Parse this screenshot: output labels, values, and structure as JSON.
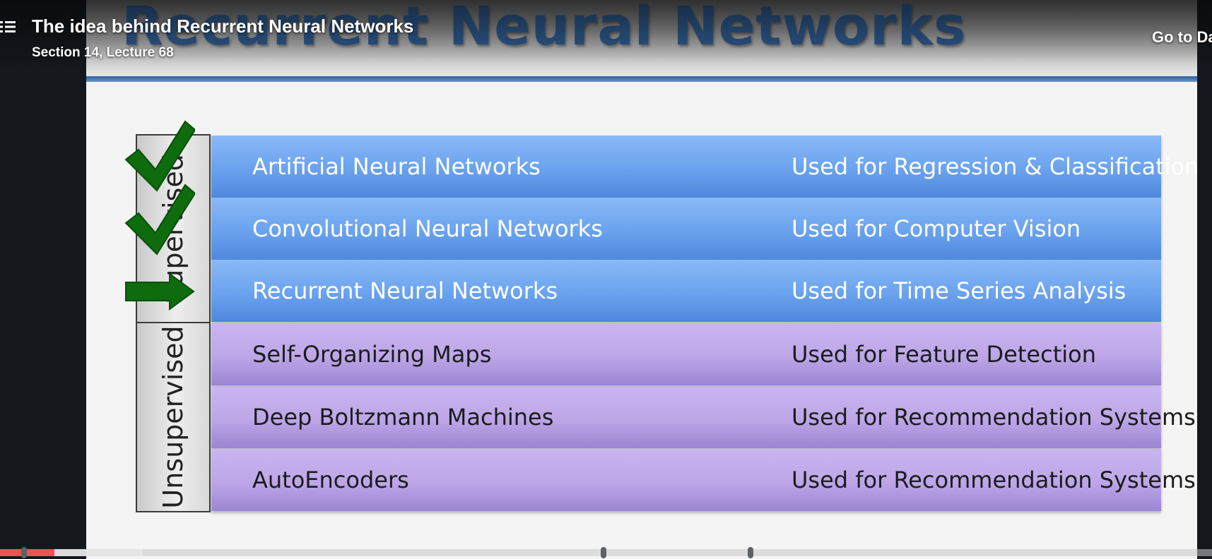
{
  "player": {
    "lecture_title": "The idea behind Recurrent Neural Networks",
    "lecture_subtitle": "Section 14, Lecture 68",
    "goto_link": "Go to Da",
    "progress": {
      "played_fraction": 0.045,
      "buffered_fraction": 0.118
    },
    "chapter_markers": [
      0.02,
      0.498,
      0.619
    ],
    "colors": {
      "progress_played": "#ec5252",
      "sidebar_bg": "#14181d"
    }
  },
  "slide": {
    "title": "Recurrent Neural Networks",
    "categories": {
      "supervised": "Supervised",
      "unsupervised": "Unsupervised"
    },
    "rows": [
      {
        "name": "Artificial Neural Networks",
        "use": "Used for Regression & Classification",
        "group": "supervised",
        "marker": "check"
      },
      {
        "name": "Convolutional Neural Networks",
        "use": "Used for Computer Vision",
        "group": "supervised",
        "marker": "check"
      },
      {
        "name": "Recurrent Neural Networks",
        "use": "Used for Time Series Analysis",
        "group": "supervised",
        "marker": "arrow"
      },
      {
        "name": "Self-Organizing Maps",
        "use": "Used for Feature Detection",
        "group": "unsupervised",
        "marker": ""
      },
      {
        "name": "Deep Boltzmann Machines",
        "use": "Used for Recommendation Systems",
        "group": "unsupervised",
        "marker": ""
      },
      {
        "name": "AutoEncoders",
        "use": "Used for Recommendation Systems",
        "group": "unsupervised",
        "marker": ""
      }
    ],
    "colors": {
      "supervised_row": "#6aa2ee",
      "unsupervised_row": "#bca6e8",
      "marker_green": "#0e6b0e",
      "title_blue": "#2f5d93"
    }
  }
}
